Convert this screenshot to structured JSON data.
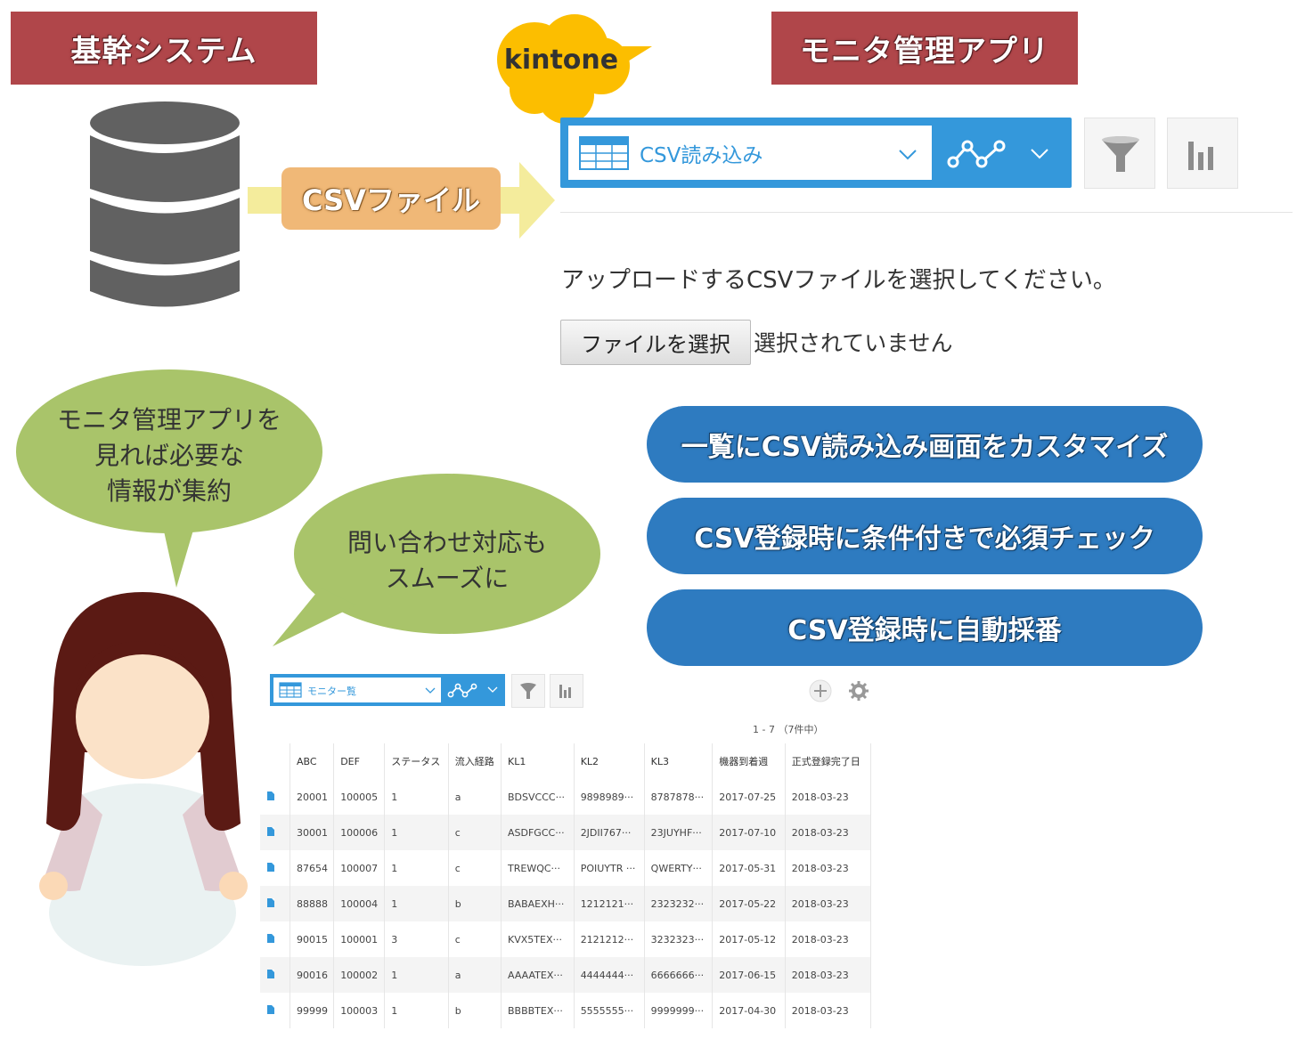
{
  "labels": {
    "kikan": "基幹システム",
    "monitor_app": "モニタ管理アプリ",
    "csv_file": "CSVファイル",
    "kintone": "kintone"
  },
  "viewbar": {
    "view_name": "CSV読み込み"
  },
  "upload": {
    "message": "アップロードするCSVファイルを選択してください。",
    "button": "ファイルを選択",
    "status": "選択されていません"
  },
  "bubbles": {
    "left_line1": "モニタ管理アプリを",
    "left_line2": "見れば必要な",
    "left_line3": "情報が集約",
    "right_line1": "問い合わせ対応も",
    "right_line2": "スムーズに"
  },
  "features": [
    "一覧にCSV読み込み画面をカスタマイズ",
    "CSV登録時に条件付きで必須チェック",
    "CSV登録時に自動採番"
  ],
  "list": {
    "view_name": "モニター覧",
    "pager": "1 - 7 （7件中）",
    "headers": [
      "ABC",
      "DEF",
      "ステータス",
      "流入経路",
      "KL1",
      "KL2",
      "KL3",
      "機器到着週",
      "正式登録完了日"
    ],
    "rows": [
      [
        "20001",
        "100005",
        "1",
        "a",
        "BDSVCCC···",
        "9898989···",
        "8787878···",
        "2017-07-25",
        "2018-03-23"
      ],
      [
        "30001",
        "100006",
        "1",
        "c",
        "ASDFGCC···",
        "2JDII767···",
        "23JUYHF···",
        "2017-07-10",
        "2018-03-23"
      ],
      [
        "87654",
        "100007",
        "1",
        "c",
        "TREWQC···",
        "POIUYTR ···",
        "QWERTY···",
        "2017-05-31",
        "2018-03-23"
      ],
      [
        "88888",
        "100004",
        "1",
        "b",
        "BABAEXH···",
        "1212121···",
        "2323232···",
        "2017-05-22",
        "2018-03-23"
      ],
      [
        "90015",
        "100001",
        "3",
        "c",
        "KVX5TEX···",
        "2121212···",
        "3232323···",
        "2017-05-12",
        "2018-03-23"
      ],
      [
        "90016",
        "100002",
        "1",
        "a",
        "AAAATEX···",
        "4444444···",
        "6666666···",
        "2017-06-15",
        "2018-03-23"
      ],
      [
        "99999",
        "100003",
        "1",
        "b",
        "BBBBTEX···",
        "5555555···",
        "9999999···",
        "2017-04-30",
        "2018-03-23"
      ]
    ]
  },
  "colors": {
    "red_label": "#b0464a",
    "orange_file": "#f0b877",
    "arrow_yellow": "#f4ec9c",
    "kintone_blue": "#3498db",
    "feature_blue": "#2e7bc0",
    "bubble_green": "#a9c46a",
    "kintone_yellow": "#fcbe00"
  }
}
